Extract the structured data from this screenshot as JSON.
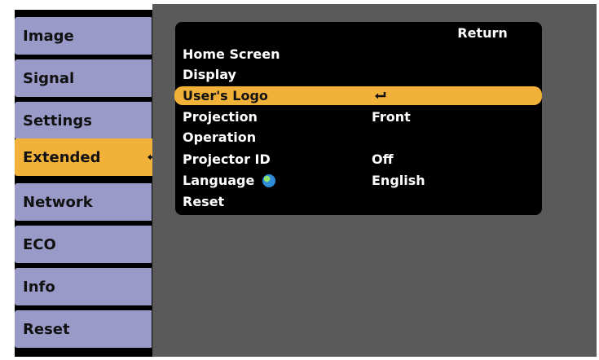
{
  "tabs": [
    {
      "label": "Image"
    },
    {
      "label": "Signal"
    },
    {
      "label": "Settings"
    },
    {
      "label": "Extended",
      "active": true
    },
    {
      "label": "Network"
    },
    {
      "label": "ECO"
    },
    {
      "label": "Info"
    },
    {
      "label": "Reset"
    }
  ],
  "menu": {
    "return_label": "Return",
    "items": [
      {
        "label": "Home Screen",
        "value": ""
      },
      {
        "label": "Display",
        "value": ""
      },
      {
        "label": "User's Logo",
        "value": "",
        "selected": true
      },
      {
        "label": "Projection",
        "value": "Front"
      },
      {
        "label": "Operation",
        "value": ""
      },
      {
        "label": "Projector ID",
        "value": "Off"
      },
      {
        "label": "Language",
        "value": "English",
        "icon": "globe-icon"
      },
      {
        "label": "Reset",
        "value": ""
      }
    ]
  },
  "colors": {
    "tab_inactive": "#9a9ac8",
    "tab_active": "#f2b23a",
    "panel_bg": "#5a5a5a",
    "highlight": "#f2b23a"
  }
}
